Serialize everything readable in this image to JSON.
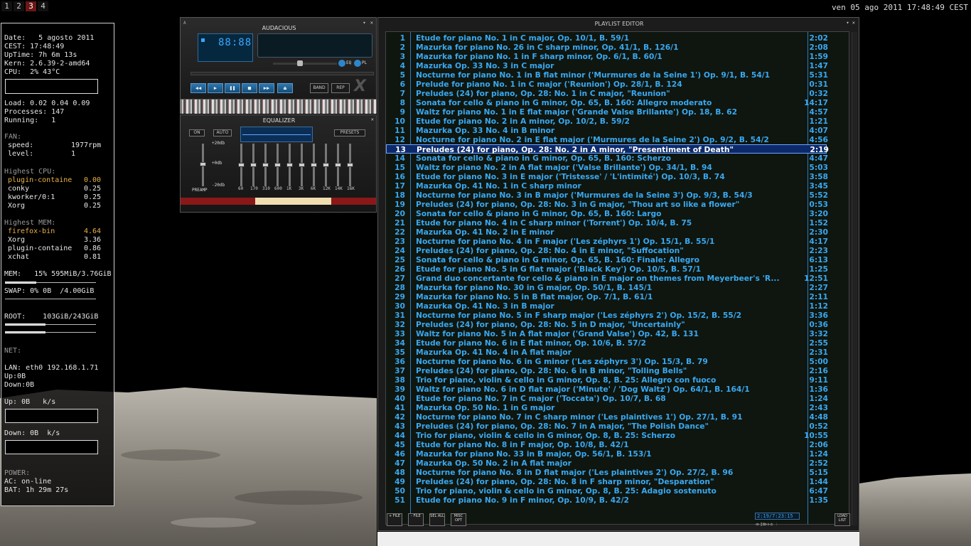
{
  "workspaces": [
    "1",
    "2",
    "3",
    "4"
  ],
  "clock": "ven 05 ago 2011 17:48:49 CEST",
  "conky": {
    "lines": [
      "Date:   5 agosto 2011",
      "CEST: 17:48:49",
      "UpTime: 7h 6m 13s",
      "Kern: 2.6.39-2-amd64",
      "CPU:  2% 43°C"
    ],
    "load": "Load: 0.02 0.04 0.09",
    "processes": "Processes: 147",
    "running": "Running:   1",
    "fan_h": "FAN:",
    "speed_l": "speed:",
    "speed_v": "1977rpm",
    "level_l": "level:",
    "level_v": "1",
    "hcpu": "Highest CPU:",
    "cpu_procs": [
      [
        "plugin-containe",
        "0.00"
      ],
      [
        "conky",
        "0.25"
      ],
      [
        "kworker/0:1",
        "0.25"
      ],
      [
        "Xorg",
        "0.25"
      ]
    ],
    "hmem": "Highest MEM:",
    "mem_procs": [
      [
        "firefox-bin",
        "4.64"
      ],
      [
        "Xorg",
        "3.36"
      ],
      [
        "plugin-containe",
        "0.86"
      ],
      [
        "xchat",
        "0.81"
      ]
    ],
    "mem": "MEM:   15% 595MiB/3.76GiB",
    "swap": "SWAP: 0% 0B  /4.00GiB",
    "root": "ROOT:    103GiB/243GiB",
    "net": "NET:",
    "lan": "LAN: eth0 192.168.1.71",
    "up": "Up:0B",
    "down": "Down:0B",
    "upk": "Up: 0B   k/s",
    "downk": "Down: 0B  k/s",
    "power": "POWER:",
    "ac": "AC: on-line",
    "bat": "BAT: 1h 29m 27s"
  },
  "main": {
    "title": "AUDACIOUS",
    "time": "88:88",
    "btn_band": "BAND",
    "btn_rep": "REP",
    "eq": "EQ",
    "pl": "PL",
    "buttons": [
      "◀◀",
      "▶",
      "❚❚",
      "■",
      "▶▶",
      "⏏"
    ]
  },
  "eq": {
    "title": "EQUALIZER",
    "on": "ON",
    "auto": "AUTO",
    "presets": "PRESETS",
    "preamp": "PREAMP",
    "db": [
      "+20db",
      "+0db",
      "-20db"
    ],
    "bands": [
      "60",
      "170",
      "310",
      "600",
      "1K",
      "3K",
      "6K",
      "12K",
      "14K",
      "16K"
    ]
  },
  "playlist": {
    "title": "PLAYLIST EDITOR",
    "info": "2:19/7:23:15",
    "load": "LOAD LIST",
    "btns": [
      "+ FILE",
      "- FILE",
      "SEL ALL",
      "MISC OPT"
    ],
    "rows": [
      [
        "1",
        "Etude for piano No.  1 in C major, Op. 10/1, B. 59/1",
        "2:02"
      ],
      [
        "2",
        "Mazurka for piano No. 26 in C sharp minor, Op. 41/1, B. 126/1",
        "2:08"
      ],
      [
        "3",
        "Mazurka for piano No.  1 in F sharp minor, Op. 6/1, B. 60/1",
        "1:59"
      ],
      [
        "4",
        "Mazurka Op. 33 No. 3 in C major",
        "1:47"
      ],
      [
        "5",
        "Nocturne for piano No.  1 in B flat minor ('Murmures de la Seine 1') Op. 9/1, B. 54/1",
        "5:31"
      ],
      [
        "6",
        "Prelude for piano No.  1 in C major ('Reunion') Op. 28/1, B. 124",
        "0:31"
      ],
      [
        "7",
        "Preludes (24) for piano, Op. 28: No. 1 in C major, \"Reunion\"",
        "0:32"
      ],
      [
        "8",
        "Sonata for cello & piano in G minor, Op. 65, B. 160: Allegro moderato",
        "14:17"
      ],
      [
        "9",
        "Waltz for piano No.  1 in E flat major ('Grande Valse Brillante') Op. 18, B. 62",
        "4:57"
      ],
      [
        "10",
        "Etude for piano No.  2 in A minor, Op. 10/2, B. 59/2",
        "1:21"
      ],
      [
        "11",
        "Mazurka Op. 33 No. 4 in B minor",
        "4:07"
      ],
      [
        "12",
        "Nocturne for piano No.  2 in E flat major ('Murmures de la Seine 2') Op. 9/2, B. 54/2",
        "4:56"
      ],
      [
        "13",
        "Preludes (24) for piano, Op. 28: No. 2 in A minor, \"Presentiment of Death\"",
        "2:19"
      ],
      [
        "14",
        "Sonata for cello & piano in G minor, Op. 65, B. 160: Scherzo",
        "4:47"
      ],
      [
        "15",
        "Waltz for piano No.  2 in A flat major ('Valse Brillante') Op. 34/1, B. 94",
        "5:03"
      ],
      [
        "16",
        "Etude for piano No.  3 in E major ('Tristesse' / 'L'intimité') Op. 10/3, B. 74",
        "3:58"
      ],
      [
        "17",
        "Mazurka Op. 41 No. 1 in C sharp minor",
        "3:45"
      ],
      [
        "18",
        "Nocturne for piano No.  3 in B major ('Murmures de la Seine 3') Op. 9/3, B. 54/3",
        "5:52"
      ],
      [
        "19",
        "Preludes (24) for piano, Op. 28: No. 3 in G major, \"Thou art so like a flower\"",
        "0:53"
      ],
      [
        "20",
        "Sonata for cello & piano in G minor, Op. 65, B. 160: Largo",
        "3:20"
      ],
      [
        "21",
        "Etude for piano No.  4 in C sharp minor ('Torrent') Op. 10/4, B. 75",
        "1:52"
      ],
      [
        "22",
        "Mazurka Op. 41 No. 2 in E minor",
        "2:30"
      ],
      [
        "23",
        "Nocturne for piano No.  4 in F major ('Les zéphyrs 1') Op. 15/1, B. 55/1",
        "4:17"
      ],
      [
        "24",
        "Preludes (24) for piano, Op. 28: No. 4 in E minor, \"Suffocation\"",
        "2:23"
      ],
      [
        "25",
        "Sonata for cello & piano in G minor, Op. 65, B. 160: Finale: Allegro",
        "6:13"
      ],
      [
        "26",
        "Etude for piano No.  5 in G flat major ('Black Key') Op. 10/5, B. 57/1",
        "1:25"
      ],
      [
        "27",
        "Grand duo concertante for cello & piano in E major on themes from Meyerbeer's 'R...",
        "12:51"
      ],
      [
        "28",
        "Mazurka for piano No. 30 in G major, Op. 50/1, B. 145/1",
        "2:27"
      ],
      [
        "29",
        "Mazurka for piano No.  5 in B flat major, Op. 7/1, B. 61/1",
        "2:11"
      ],
      [
        "30",
        "Mazurka Op. 41 No. 3 in B major",
        "1:12"
      ],
      [
        "31",
        "Nocturne for piano No.  5 in F sharp major ('Les zéphyrs 2') Op. 15/2, B. 55/2",
        "3:36"
      ],
      [
        "32",
        "Preludes (24) for piano, Op. 28: No. 5 in D major, \"Uncertainly\"",
        "0:36"
      ],
      [
        "33",
        "Waltz for piano No.  5 in A flat major ('Grand Valse') Op. 42, B. 131",
        "3:32"
      ],
      [
        "34",
        "Etude for piano No.  6 in E flat minor, Op. 10/6, B. 57/2",
        "2:55"
      ],
      [
        "35",
        "Mazurka Op. 41 No. 4 in A flat major",
        "2:31"
      ],
      [
        "36",
        "Nocturne for piano No.  6 in G minor ('Les zéphyrs 3') Op. 15/3, B. 79",
        "5:00"
      ],
      [
        "37",
        "Preludes (24) for piano, Op. 28: No. 6 in B minor, \"Tolling Bells\"",
        "2:16"
      ],
      [
        "38",
        "Trio for piano, violin & cello in G minor, Op. 8, B. 25: Allegro con fuoco",
        "9:11"
      ],
      [
        "39",
        "Waltz for piano No.  6 in D flat major ('Minute' / 'Dog Waltz') Op. 64/1, B. 164/1",
        "1:36"
      ],
      [
        "40",
        "Etude for piano No.  7 in C major ('Toccata') Op. 10/7, B. 68",
        "1:24"
      ],
      [
        "41",
        "Mazurka Op. 50 No. 1 in G major",
        "2:43"
      ],
      [
        "42",
        "Nocturne for piano No.  7 in C sharp minor ('Les plaintives 1') Op. 27/1, B. 91",
        "4:48"
      ],
      [
        "43",
        "Preludes (24) for piano, Op. 28: No. 7 in A major, \"The Polish Dance\"",
        "0:52"
      ],
      [
        "44",
        "Trio for piano, violin & cello in G minor, Op. 8, B. 25: Scherzo",
        "10:55"
      ],
      [
        "45",
        "Etude for piano No.  8 in F major, Op. 10/8, B. 42/1",
        "2:06"
      ],
      [
        "46",
        "Mazurka for piano No. 33 in B major, Op. 56/1, B. 153/1",
        "1:24"
      ],
      [
        "47",
        "Mazurka Op. 50 No. 2 in A flat major",
        "2:52"
      ],
      [
        "48",
        "Nocturne for piano No.  8 in D flat major ('Les plaintives 2') Op. 27/2, B. 96",
        "5:15"
      ],
      [
        "49",
        "Preludes (24) for piano, Op. 28: No. 8 in F sharp minor, \"Desparation\"",
        "1:44"
      ],
      [
        "50",
        "Trio for piano, violin & cello in G minor, Op. 8, B. 25: Adagio sostenuto",
        "6:47"
      ],
      [
        "51",
        "Etude for piano No.  9 in F minor, Op. 10/9, B. 42/2",
        "1:35"
      ]
    ],
    "selected": 12
  },
  "colors": {
    "accent": "#39a8f0",
    "selected_row": "#0c2a6a",
    "workspace_active": "#6b1717",
    "conky_highlight": "#e8b24a"
  }
}
